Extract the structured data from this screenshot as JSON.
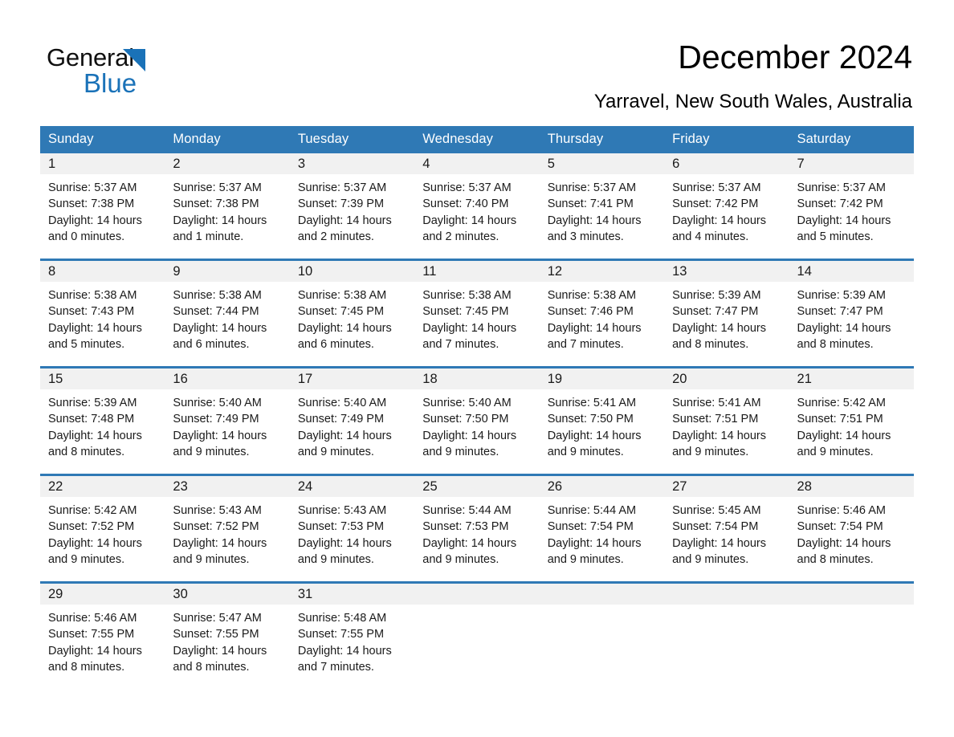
{
  "brand": {
    "name_part1": "General",
    "name_part2": "Blue",
    "triangle_color": "#1a72b8"
  },
  "header": {
    "title": "December 2024",
    "subtitle": "Yarravel, New South Wales, Australia"
  },
  "calendar": {
    "header_bg": "#2f79b5",
    "daynum_bg": "#f1f1f1",
    "weekday_headers": [
      "Sunday",
      "Monday",
      "Tuesday",
      "Wednesday",
      "Thursday",
      "Friday",
      "Saturday"
    ],
    "weeks": [
      [
        {
          "day": "1",
          "sunrise": "Sunrise: 5:37 AM",
          "sunset": "Sunset: 7:38 PM",
          "daylight_line1": "Daylight: 14 hours",
          "daylight_line2": "and 0 minutes."
        },
        {
          "day": "2",
          "sunrise": "Sunrise: 5:37 AM",
          "sunset": "Sunset: 7:38 PM",
          "daylight_line1": "Daylight: 14 hours",
          "daylight_line2": "and 1 minute."
        },
        {
          "day": "3",
          "sunrise": "Sunrise: 5:37 AM",
          "sunset": "Sunset: 7:39 PM",
          "daylight_line1": "Daylight: 14 hours",
          "daylight_line2": "and 2 minutes."
        },
        {
          "day": "4",
          "sunrise": "Sunrise: 5:37 AM",
          "sunset": "Sunset: 7:40 PM",
          "daylight_line1": "Daylight: 14 hours",
          "daylight_line2": "and 2 minutes."
        },
        {
          "day": "5",
          "sunrise": "Sunrise: 5:37 AM",
          "sunset": "Sunset: 7:41 PM",
          "daylight_line1": "Daylight: 14 hours",
          "daylight_line2": "and 3 minutes."
        },
        {
          "day": "6",
          "sunrise": "Sunrise: 5:37 AM",
          "sunset": "Sunset: 7:42 PM",
          "daylight_line1": "Daylight: 14 hours",
          "daylight_line2": "and 4 minutes."
        },
        {
          "day": "7",
          "sunrise": "Sunrise: 5:37 AM",
          "sunset": "Sunset: 7:42 PM",
          "daylight_line1": "Daylight: 14 hours",
          "daylight_line2": "and 5 minutes."
        }
      ],
      [
        {
          "day": "8",
          "sunrise": "Sunrise: 5:38 AM",
          "sunset": "Sunset: 7:43 PM",
          "daylight_line1": "Daylight: 14 hours",
          "daylight_line2": "and 5 minutes."
        },
        {
          "day": "9",
          "sunrise": "Sunrise: 5:38 AM",
          "sunset": "Sunset: 7:44 PM",
          "daylight_line1": "Daylight: 14 hours",
          "daylight_line2": "and 6 minutes."
        },
        {
          "day": "10",
          "sunrise": "Sunrise: 5:38 AM",
          "sunset": "Sunset: 7:45 PM",
          "daylight_line1": "Daylight: 14 hours",
          "daylight_line2": "and 6 minutes."
        },
        {
          "day": "11",
          "sunrise": "Sunrise: 5:38 AM",
          "sunset": "Sunset: 7:45 PM",
          "daylight_line1": "Daylight: 14 hours",
          "daylight_line2": "and 7 minutes."
        },
        {
          "day": "12",
          "sunrise": "Sunrise: 5:38 AM",
          "sunset": "Sunset: 7:46 PM",
          "daylight_line1": "Daylight: 14 hours",
          "daylight_line2": "and 7 minutes."
        },
        {
          "day": "13",
          "sunrise": "Sunrise: 5:39 AM",
          "sunset": "Sunset: 7:47 PM",
          "daylight_line1": "Daylight: 14 hours",
          "daylight_line2": "and 8 minutes."
        },
        {
          "day": "14",
          "sunrise": "Sunrise: 5:39 AM",
          "sunset": "Sunset: 7:47 PM",
          "daylight_line1": "Daylight: 14 hours",
          "daylight_line2": "and 8 minutes."
        }
      ],
      [
        {
          "day": "15",
          "sunrise": "Sunrise: 5:39 AM",
          "sunset": "Sunset: 7:48 PM",
          "daylight_line1": "Daylight: 14 hours",
          "daylight_line2": "and 8 minutes."
        },
        {
          "day": "16",
          "sunrise": "Sunrise: 5:40 AM",
          "sunset": "Sunset: 7:49 PM",
          "daylight_line1": "Daylight: 14 hours",
          "daylight_line2": "and 9 minutes."
        },
        {
          "day": "17",
          "sunrise": "Sunrise: 5:40 AM",
          "sunset": "Sunset: 7:49 PM",
          "daylight_line1": "Daylight: 14 hours",
          "daylight_line2": "and 9 minutes."
        },
        {
          "day": "18",
          "sunrise": "Sunrise: 5:40 AM",
          "sunset": "Sunset: 7:50 PM",
          "daylight_line1": "Daylight: 14 hours",
          "daylight_line2": "and 9 minutes."
        },
        {
          "day": "19",
          "sunrise": "Sunrise: 5:41 AM",
          "sunset": "Sunset: 7:50 PM",
          "daylight_line1": "Daylight: 14 hours",
          "daylight_line2": "and 9 minutes."
        },
        {
          "day": "20",
          "sunrise": "Sunrise: 5:41 AM",
          "sunset": "Sunset: 7:51 PM",
          "daylight_line1": "Daylight: 14 hours",
          "daylight_line2": "and 9 minutes."
        },
        {
          "day": "21",
          "sunrise": "Sunrise: 5:42 AM",
          "sunset": "Sunset: 7:51 PM",
          "daylight_line1": "Daylight: 14 hours",
          "daylight_line2": "and 9 minutes."
        }
      ],
      [
        {
          "day": "22",
          "sunrise": "Sunrise: 5:42 AM",
          "sunset": "Sunset: 7:52 PM",
          "daylight_line1": "Daylight: 14 hours",
          "daylight_line2": "and 9 minutes."
        },
        {
          "day": "23",
          "sunrise": "Sunrise: 5:43 AM",
          "sunset": "Sunset: 7:52 PM",
          "daylight_line1": "Daylight: 14 hours",
          "daylight_line2": "and 9 minutes."
        },
        {
          "day": "24",
          "sunrise": "Sunrise: 5:43 AM",
          "sunset": "Sunset: 7:53 PM",
          "daylight_line1": "Daylight: 14 hours",
          "daylight_line2": "and 9 minutes."
        },
        {
          "day": "25",
          "sunrise": "Sunrise: 5:44 AM",
          "sunset": "Sunset: 7:53 PM",
          "daylight_line1": "Daylight: 14 hours",
          "daylight_line2": "and 9 minutes."
        },
        {
          "day": "26",
          "sunrise": "Sunrise: 5:44 AM",
          "sunset": "Sunset: 7:54 PM",
          "daylight_line1": "Daylight: 14 hours",
          "daylight_line2": "and 9 minutes."
        },
        {
          "day": "27",
          "sunrise": "Sunrise: 5:45 AM",
          "sunset": "Sunset: 7:54 PM",
          "daylight_line1": "Daylight: 14 hours",
          "daylight_line2": "and 9 minutes."
        },
        {
          "day": "28",
          "sunrise": "Sunrise: 5:46 AM",
          "sunset": "Sunset: 7:54 PM",
          "daylight_line1": "Daylight: 14 hours",
          "daylight_line2": "and 8 minutes."
        }
      ],
      [
        {
          "day": "29",
          "sunrise": "Sunrise: 5:46 AM",
          "sunset": "Sunset: 7:55 PM",
          "daylight_line1": "Daylight: 14 hours",
          "daylight_line2": "and 8 minutes."
        },
        {
          "day": "30",
          "sunrise": "Sunrise: 5:47 AM",
          "sunset": "Sunset: 7:55 PM",
          "daylight_line1": "Daylight: 14 hours",
          "daylight_line2": "and 8 minutes."
        },
        {
          "day": "31",
          "sunrise": "Sunrise: 5:48 AM",
          "sunset": "Sunset: 7:55 PM",
          "daylight_line1": "Daylight: 14 hours",
          "daylight_line2": "and 7 minutes."
        },
        {
          "day": "",
          "sunrise": "",
          "sunset": "",
          "daylight_line1": "",
          "daylight_line2": ""
        },
        {
          "day": "",
          "sunrise": "",
          "sunset": "",
          "daylight_line1": "",
          "daylight_line2": ""
        },
        {
          "day": "",
          "sunrise": "",
          "sunset": "",
          "daylight_line1": "",
          "daylight_line2": ""
        },
        {
          "day": "",
          "sunrise": "",
          "sunset": "",
          "daylight_line1": "",
          "daylight_line2": ""
        }
      ]
    ]
  }
}
